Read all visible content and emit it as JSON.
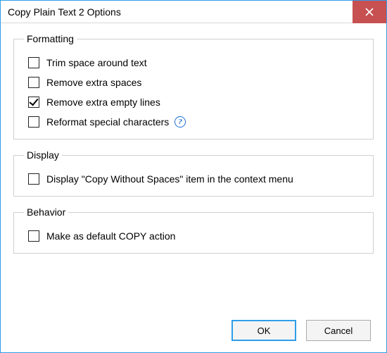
{
  "window": {
    "title": "Copy Plain Text 2 Options"
  },
  "groups": {
    "formatting": {
      "legend": "Formatting",
      "opt_trim": {
        "label": "Trim space around text",
        "checked": false
      },
      "opt_remove_spaces": {
        "label": "Remove extra spaces",
        "checked": false
      },
      "opt_remove_lines": {
        "label": "Remove extra empty lines",
        "checked": true
      },
      "opt_reformat": {
        "label": "Reformat special characters",
        "checked": false
      }
    },
    "display": {
      "legend": "Display",
      "opt_context_menu": {
        "label": "Display \"Copy Without Spaces\" item in the context menu",
        "checked": false
      }
    },
    "behavior": {
      "legend": "Behavior",
      "opt_default_copy": {
        "label": "Make as default COPY action",
        "checked": false
      }
    }
  },
  "buttons": {
    "ok": "OK",
    "cancel": "Cancel"
  }
}
